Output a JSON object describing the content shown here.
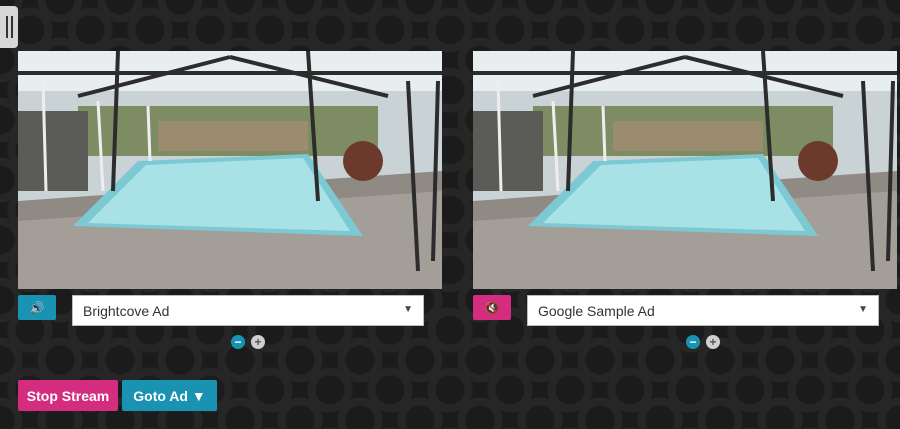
{
  "colors": {
    "accent_teal": "#1a93b3",
    "accent_pink": "#d42d7f",
    "zoom_minus": "#1a93b3",
    "zoom_plus": "#cfcfcf"
  },
  "drawer": {
    "icon": "drag-handle-icon"
  },
  "players": [
    {
      "audio_icon": "volume-icon",
      "audio_glyph": "🔊",
      "ad_select": {
        "selected": "Brightcove Ad",
        "arrow": "▼"
      },
      "zoom": {
        "minus": "−",
        "plus": "+"
      }
    },
    {
      "audio_icon": "muted-icon",
      "audio_glyph": "🔇",
      "ad_select": {
        "selected": "Google Sample Ad",
        "arrow": "▼"
      },
      "zoom": {
        "minus": "−",
        "plus": "+"
      }
    }
  ],
  "actions": {
    "stop_stream": "Stop Stream",
    "goto_ad": "Goto Ad ▼"
  }
}
